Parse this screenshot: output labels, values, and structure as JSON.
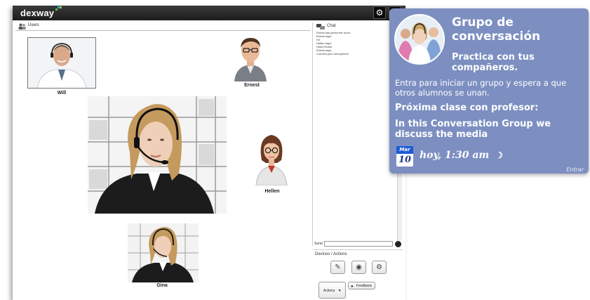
{
  "app": {
    "logo": "dexway",
    "settings_icon": "gear-icon",
    "help_icon": "question-icon"
  },
  "users_panel": {
    "title": "Users",
    "participants": [
      {
        "name": "Will",
        "kind": "photo"
      },
      {
        "name": "Ernest",
        "kind": "avatar"
      },
      {
        "name": "",
        "kind": "photo-large"
      },
      {
        "name": "Hellen",
        "kind": "avatar"
      },
      {
        "name": "Gina",
        "kind": "photo"
      }
    ]
  },
  "chat": {
    "title": "Chat",
    "messages": [
      "Ernest has joined the room.",
      "Ernest says:",
      "Hi!",
      "Hellen says:",
      "Hello Ernest",
      "Ernest says:",
      "Connect your microphone"
    ],
    "send_label": "Send",
    "send_value": ""
  },
  "devices": {
    "title": "Devices / Actions",
    "buttons": [
      "microphone-icon",
      "camera-icon",
      "settings-icon"
    ],
    "actions_label": "Actions",
    "feedback_label": "Feedback"
  },
  "card": {
    "title": "Grupo de conversación",
    "subtitle": "Practica con tus compañeros.",
    "description": "Entra para iniciar un grupo y espera a que otros alumnos se unan.",
    "next_class": "Próxima clase con profesor:",
    "topic": "In this Conversation Group we discuss the media",
    "calendar_month": "Mar",
    "calendar_day": "10",
    "time": "hoy, 1:30 am",
    "enter_label": "Entrar",
    "colors": {
      "background": "#7d8fc1",
      "calendar_accent": "#1e5bd6"
    }
  }
}
